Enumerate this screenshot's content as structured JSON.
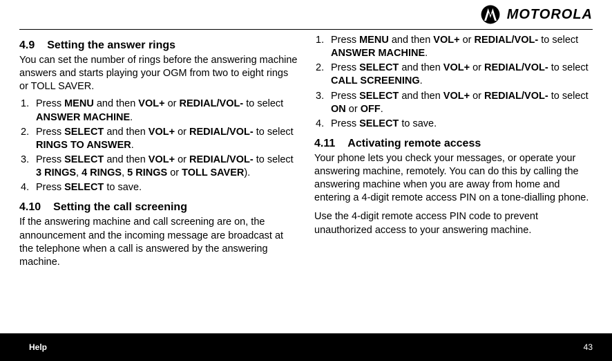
{
  "brand": "MOTOROLA",
  "footer": {
    "left": "Help",
    "right": "43"
  },
  "s49": {
    "num": "4.9",
    "title": "Setting the answer rings",
    "intro": "You can set the number of rings before the answering machine answers and starts playing your OGM from two to eight rings or TOLL SAVER.",
    "li1a": "Press ",
    "li1b": "MENU",
    "li1c": " and then ",
    "li1d": "VOL+",
    "li1e": " or ",
    "li1f": "REDIAL/VOL-",
    "li1g": " to select ",
    "li1h": "ANSWER MACHINE",
    "li1i": ".",
    "li2a": "Press ",
    "li2b": "SELECT",
    "li2c": " and then ",
    "li2d": "VOL+",
    "li2e": " or ",
    "li2f": "REDIAL/VOL-",
    "li2g": " to select ",
    "li2h": "RINGS TO ANSWER",
    "li2i": ".",
    "li3a": "Press ",
    "li3b": "SELECT",
    "li3c": " and then ",
    "li3d": "VOL+",
    "li3e": " or ",
    "li3f": "REDIAL/VOL-",
    "li3g": " to select ",
    "li3h": "3 RINGS",
    "li3i": ", ",
    "li3j": "4 RINGS",
    "li3k": ", ",
    "li3l": "5 RINGS",
    "li3m": " or ",
    "li3n": "TOLL SAVER",
    "li3o": ").",
    "li4a": "Press ",
    "li4b": "SELECT",
    "li4c": " to save."
  },
  "s410": {
    "num": "4.10",
    "title": "Setting the call screening",
    "intro": "If the answering machine and call screening are on, the announcement and the incoming message are broadcast at the telephone when a call is answered by the answering machine.",
    "li1a": "Press ",
    "li1b": "MENU",
    "li1c": " and then ",
    "li1d": "VOL+",
    "li1e": " or ",
    "li1f": "REDIAL/VOL-",
    "li1g": " to select ",
    "li1h": "ANSWER MACHINE",
    "li1i": ".",
    "li2a": "Press ",
    "li2b": "SELECT",
    "li2c": " and then ",
    "li2d": "VOL+",
    "li2e": " or ",
    "li2f": "REDIAL/VOL-",
    "li2g": " to select ",
    "li2h": "CALL SCREENING",
    "li2i": ".",
    "li3a": "Press ",
    "li3b": "SELECT",
    "li3c": " and then ",
    "li3d": "VOL+",
    "li3e": " or ",
    "li3f": "REDIAL/VOL-",
    "li3g": " to select ",
    "li3h": "ON",
    "li3i": " or ",
    "li3j": "OFF",
    "li3k": ".",
    "li4a": "Press ",
    "li4b": "SELECT",
    "li4c": " to save."
  },
  "s411": {
    "num": "4.11",
    "title": "Activating remote access",
    "p1": "Your phone lets you check your messages, or operate your answering machine, remotely. You can do this by calling the answering machine when you are away from home and entering a 4-digit remote access PIN on a tone-dialling phone.",
    "p2": "Use the 4-digit remote access PIN code to prevent unauthorized access to your answering machine."
  }
}
